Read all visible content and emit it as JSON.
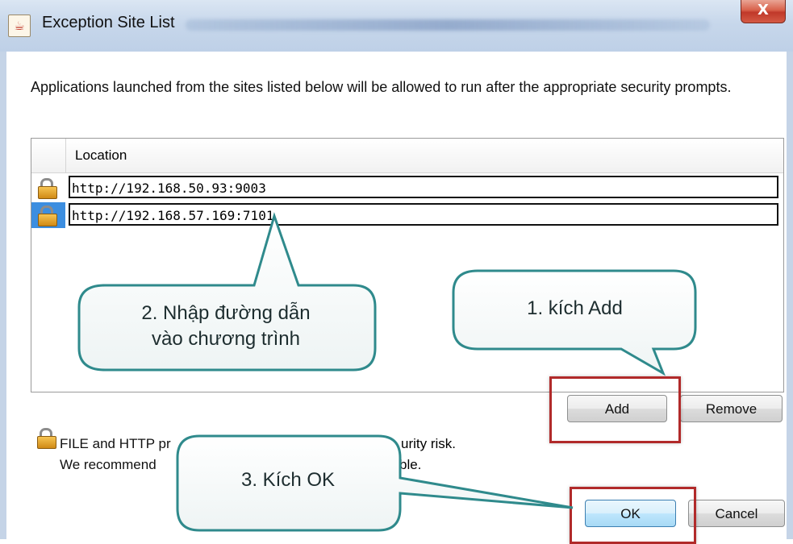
{
  "window": {
    "title": "Exception Site List",
    "close_label": "X"
  },
  "description": "Applications launched from the sites listed below will be allowed to run after the appropriate security prompts.",
  "table": {
    "column_location": "Location",
    "rows": [
      {
        "url": "http://192.168.50.93:9003",
        "selected": false
      },
      {
        "url": "http://192.168.57.169:7101",
        "selected": true
      }
    ]
  },
  "buttons": {
    "add": "Add",
    "remove": "Remove",
    "ok": "OK",
    "cancel": "Cancel"
  },
  "footer": {
    "line1": "FILE and HTTP pr",
    "line1_end": "urity risk.",
    "line2": "We recommend",
    "line2_end": "ble."
  },
  "callouts": {
    "enter_path_line1": "2. Nhập đường dẫn",
    "enter_path_line2": "vào chương trình",
    "click_add": "1. kích Add",
    "click_ok": "3. Kích OK"
  },
  "colors": {
    "callout_border": "#2f8a8c",
    "highlight_red": "#b12a2a",
    "selection_blue": "#3c8ee0"
  }
}
